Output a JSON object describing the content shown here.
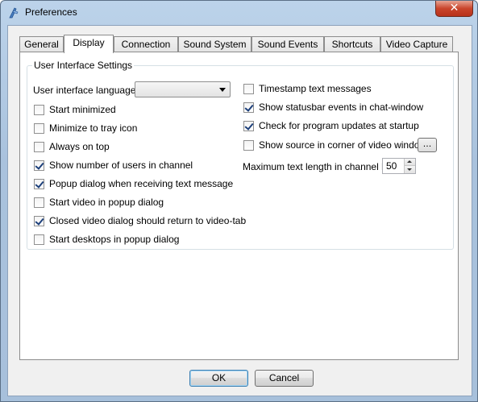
{
  "window": {
    "title": "Preferences",
    "close_glyph": "✕"
  },
  "tabs": [
    {
      "label": "General"
    },
    {
      "label": "Display",
      "active": true
    },
    {
      "label": "Connection"
    },
    {
      "label": "Sound System"
    },
    {
      "label": "Sound Events"
    },
    {
      "label": "Shortcuts"
    },
    {
      "label": "Video Capture"
    }
  ],
  "group": {
    "title": "User Interface Settings",
    "language": {
      "label": "User interface language",
      "value": ""
    },
    "left_options": [
      {
        "label": "Start minimized",
        "checked": false
      },
      {
        "label": "Minimize to tray icon",
        "checked": false
      },
      {
        "label": "Always on top",
        "checked": false
      },
      {
        "label": "Show number of users in channel",
        "checked": true
      },
      {
        "label": "Popup dialog when receiving text message",
        "checked": true
      },
      {
        "label": "Start video in popup dialog",
        "checked": false
      },
      {
        "label": "Closed video dialog should return to video-tab",
        "checked": true
      },
      {
        "label": "Start desktops in popup dialog",
        "checked": false
      }
    ],
    "right_options": [
      {
        "label": "Timestamp text messages",
        "checked": false
      },
      {
        "label": "Show statusbar events in chat-window",
        "checked": true
      },
      {
        "label": "Check for program updates at startup",
        "checked": true
      },
      {
        "label": "Show source in corner of video window",
        "checked": false
      }
    ],
    "browse_label": "...",
    "max_text": {
      "label": "Maximum text length in channel list",
      "value": "50"
    }
  },
  "buttons": {
    "ok": "OK",
    "cancel": "Cancel"
  },
  "icons": {
    "app_icon": "app-logo-icon",
    "checkmark": "check-icon"
  }
}
